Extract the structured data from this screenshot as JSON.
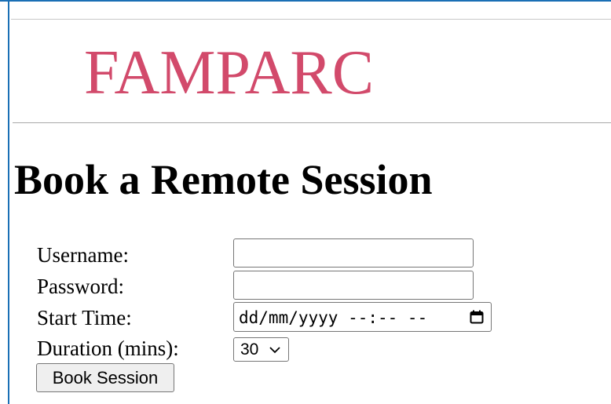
{
  "brand": {
    "logo_text": "FAMPARC",
    "logo_color": "#d24a6b"
  },
  "page": {
    "title": "Book a Remote Session"
  },
  "form": {
    "username": {
      "label": "Username:",
      "value": ""
    },
    "password": {
      "label": "Password:",
      "value": ""
    },
    "start_time": {
      "label": "Start Time:",
      "display": "dd/mm/yyyy --:-- --",
      "icon": "calendar-icon"
    },
    "duration": {
      "label": "Duration (mins):",
      "selected": "30",
      "icon": "chevron-down-icon"
    },
    "submit_label": "Book Session"
  },
  "colors": {
    "frame": "#1a6fb5",
    "logo": "#d24a6b"
  }
}
